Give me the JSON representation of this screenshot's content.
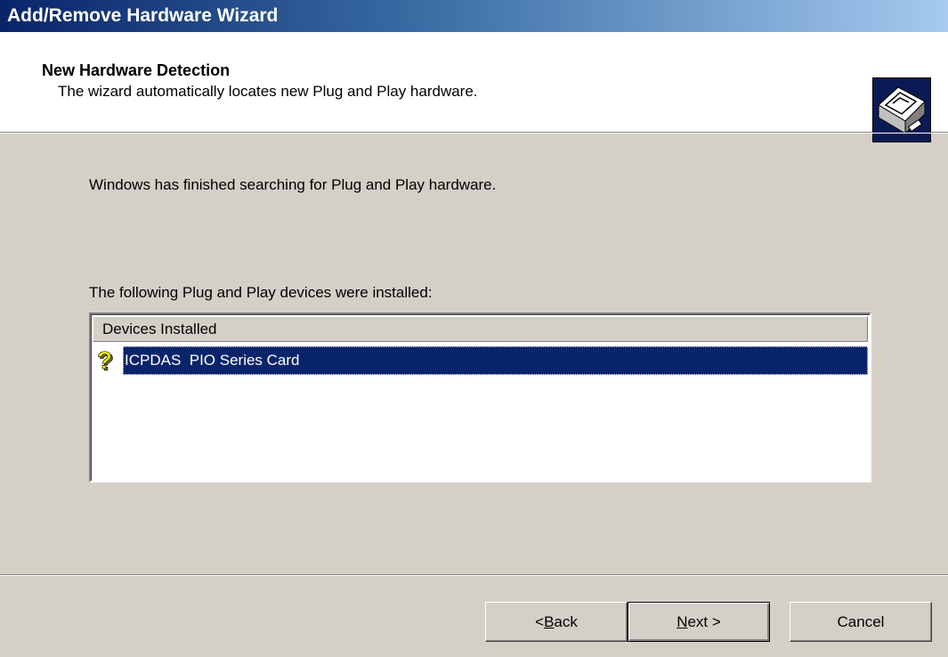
{
  "window": {
    "title": "Add/Remove Hardware Wizard"
  },
  "header": {
    "title": "New Hardware Detection",
    "subtitle": "The wizard automatically locates new Plug and Play hardware.",
    "icon": "hardware-card-icon"
  },
  "body": {
    "intro": "Windows has finished searching for Plug and Play hardware.",
    "list_label": "The following Plug and Play devices were installed:",
    "list": {
      "column_header": "Devices Installed",
      "items": [
        {
          "label": "ICPDAS  PIO Series Card",
          "icon": "unknown-device-icon",
          "selected": true
        }
      ]
    }
  },
  "buttons": {
    "back": {
      "prefix": "< ",
      "accel": "B",
      "rest": "ack"
    },
    "next": {
      "accel": "N",
      "rest": "ext >"
    },
    "cancel": "Cancel"
  }
}
